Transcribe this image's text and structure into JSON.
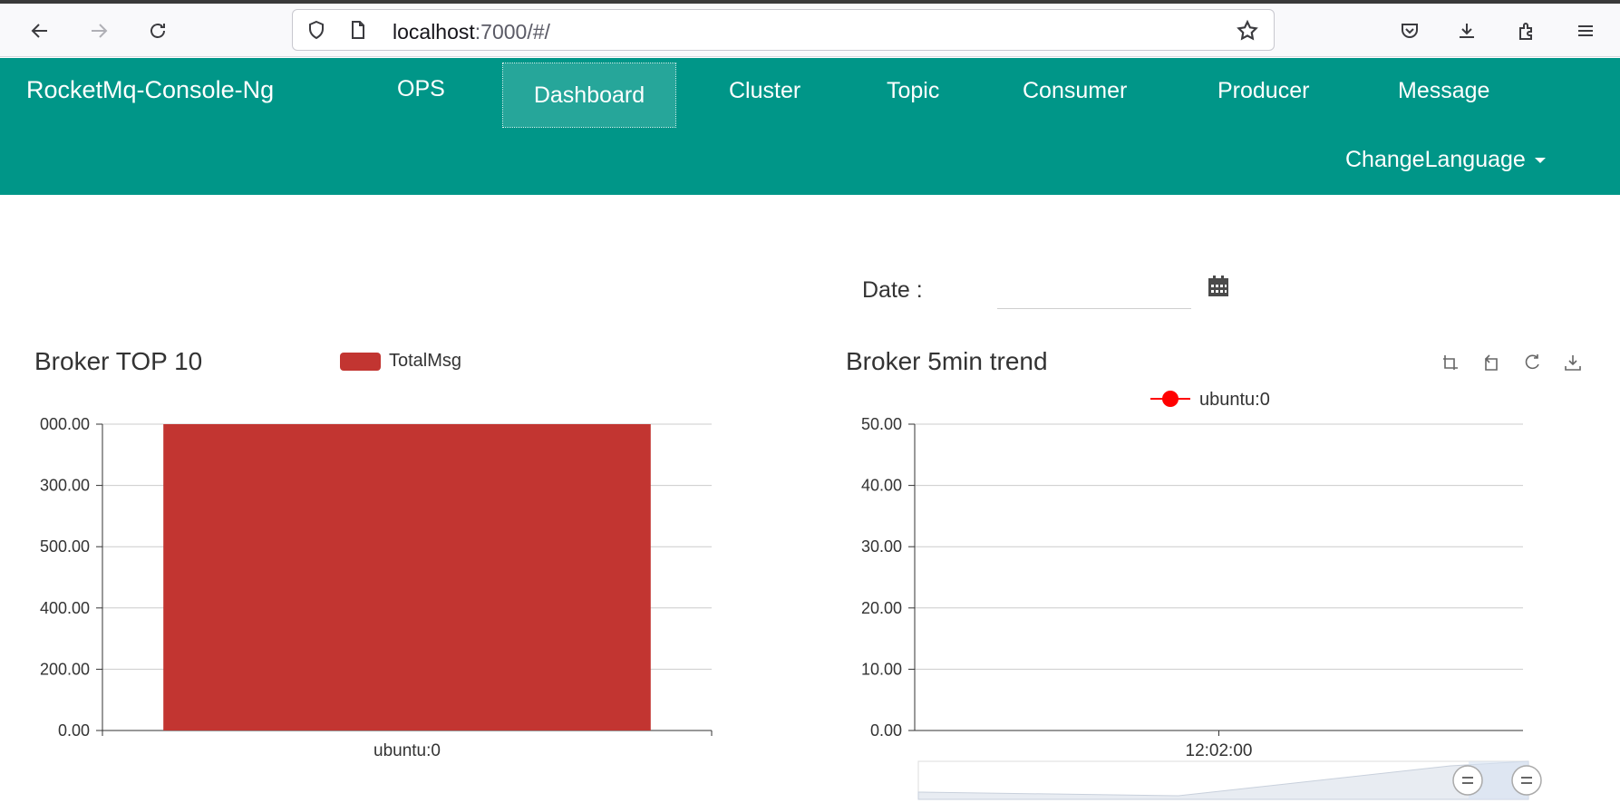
{
  "browser": {
    "url_host": "localhost",
    "url_rest": ":7000/#/"
  },
  "navbar": {
    "brand": "RocketMq-Console-Ng",
    "items": [
      {
        "label": "OPS"
      },
      {
        "label": "Dashboard",
        "active": true
      },
      {
        "label": "Cluster"
      },
      {
        "label": "Topic"
      },
      {
        "label": "Consumer"
      },
      {
        "label": "Producer"
      },
      {
        "label": "Message"
      }
    ],
    "change_language": "ChangeLanguage",
    "bg_color": "#009688"
  },
  "date_filter": {
    "label": "Date :",
    "value": ""
  },
  "chart_data": [
    {
      "type": "bar",
      "title": "Broker TOP 10",
      "legend": [
        "TotalMsg"
      ],
      "legend_position": "top",
      "categories": [
        "ubuntu:0"
      ],
      "series": [
        {
          "name": "TotalMsg",
          "values": [
            1000
          ],
          "color": "#c23531"
        }
      ],
      "y_tick_labels": [
        "000.00",
        "300.00",
        "500.00",
        "400.00",
        "200.00",
        "0.00"
      ],
      "ylim": [
        0,
        1000
      ],
      "grid": true
    },
    {
      "type": "line",
      "title": "Broker 5min trend",
      "legend": [
        "ubuntu:0"
      ],
      "legend_position": "top",
      "x": [
        "12:02:00"
      ],
      "series": [
        {
          "name": "ubuntu:0",
          "values": [],
          "color": "#ff0000"
        }
      ],
      "y_ticks": [
        "50.00",
        "40.00",
        "30.00",
        "20.00",
        "10.00",
        "0.00"
      ],
      "ylim": [
        0,
        50
      ],
      "grid": true,
      "toolbox": [
        "data-zoom-icon",
        "zoom-reset-icon",
        "restore-icon",
        "save-image-icon"
      ]
    }
  ]
}
